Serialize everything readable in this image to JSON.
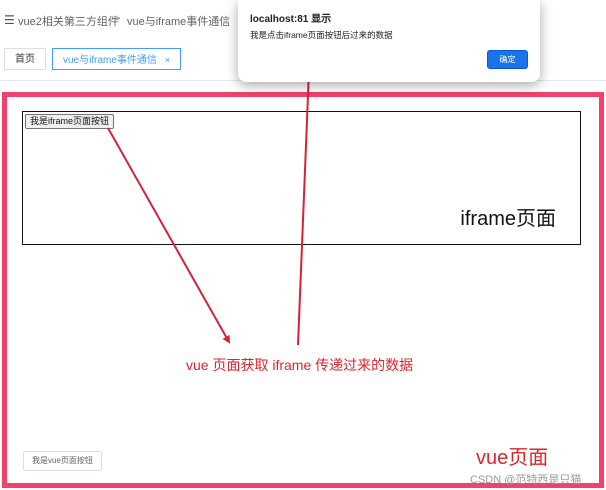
{
  "header": {
    "menu_icon": "hamburger-icon",
    "breadcrumb": [
      "vue2相关第三方组件",
      "vue与iframe事件通信"
    ],
    "separator": ">"
  },
  "tabs": [
    {
      "label": "首页",
      "active": false
    },
    {
      "label": "vue与iframe事件通信",
      "active": true,
      "close": "×"
    }
  ],
  "iframe": {
    "button_label": "我是iframe页面按钮",
    "label": "iframe页面"
  },
  "annotation": {
    "caption": "vue 页面获取 iframe 传递过来的数据",
    "color": "#e0252b"
  },
  "vue_page": {
    "button_label": "我是vue页面按钮",
    "label": "vue页面",
    "border_color": "#f0426c"
  },
  "dialog": {
    "title": "localhost:81 显示",
    "message": "我是点击iframe页面按钮后过来的数据",
    "ok_label": "确定",
    "ok_color": "#1a73e8"
  },
  "watermark": "CSDN @范特西是只猫"
}
